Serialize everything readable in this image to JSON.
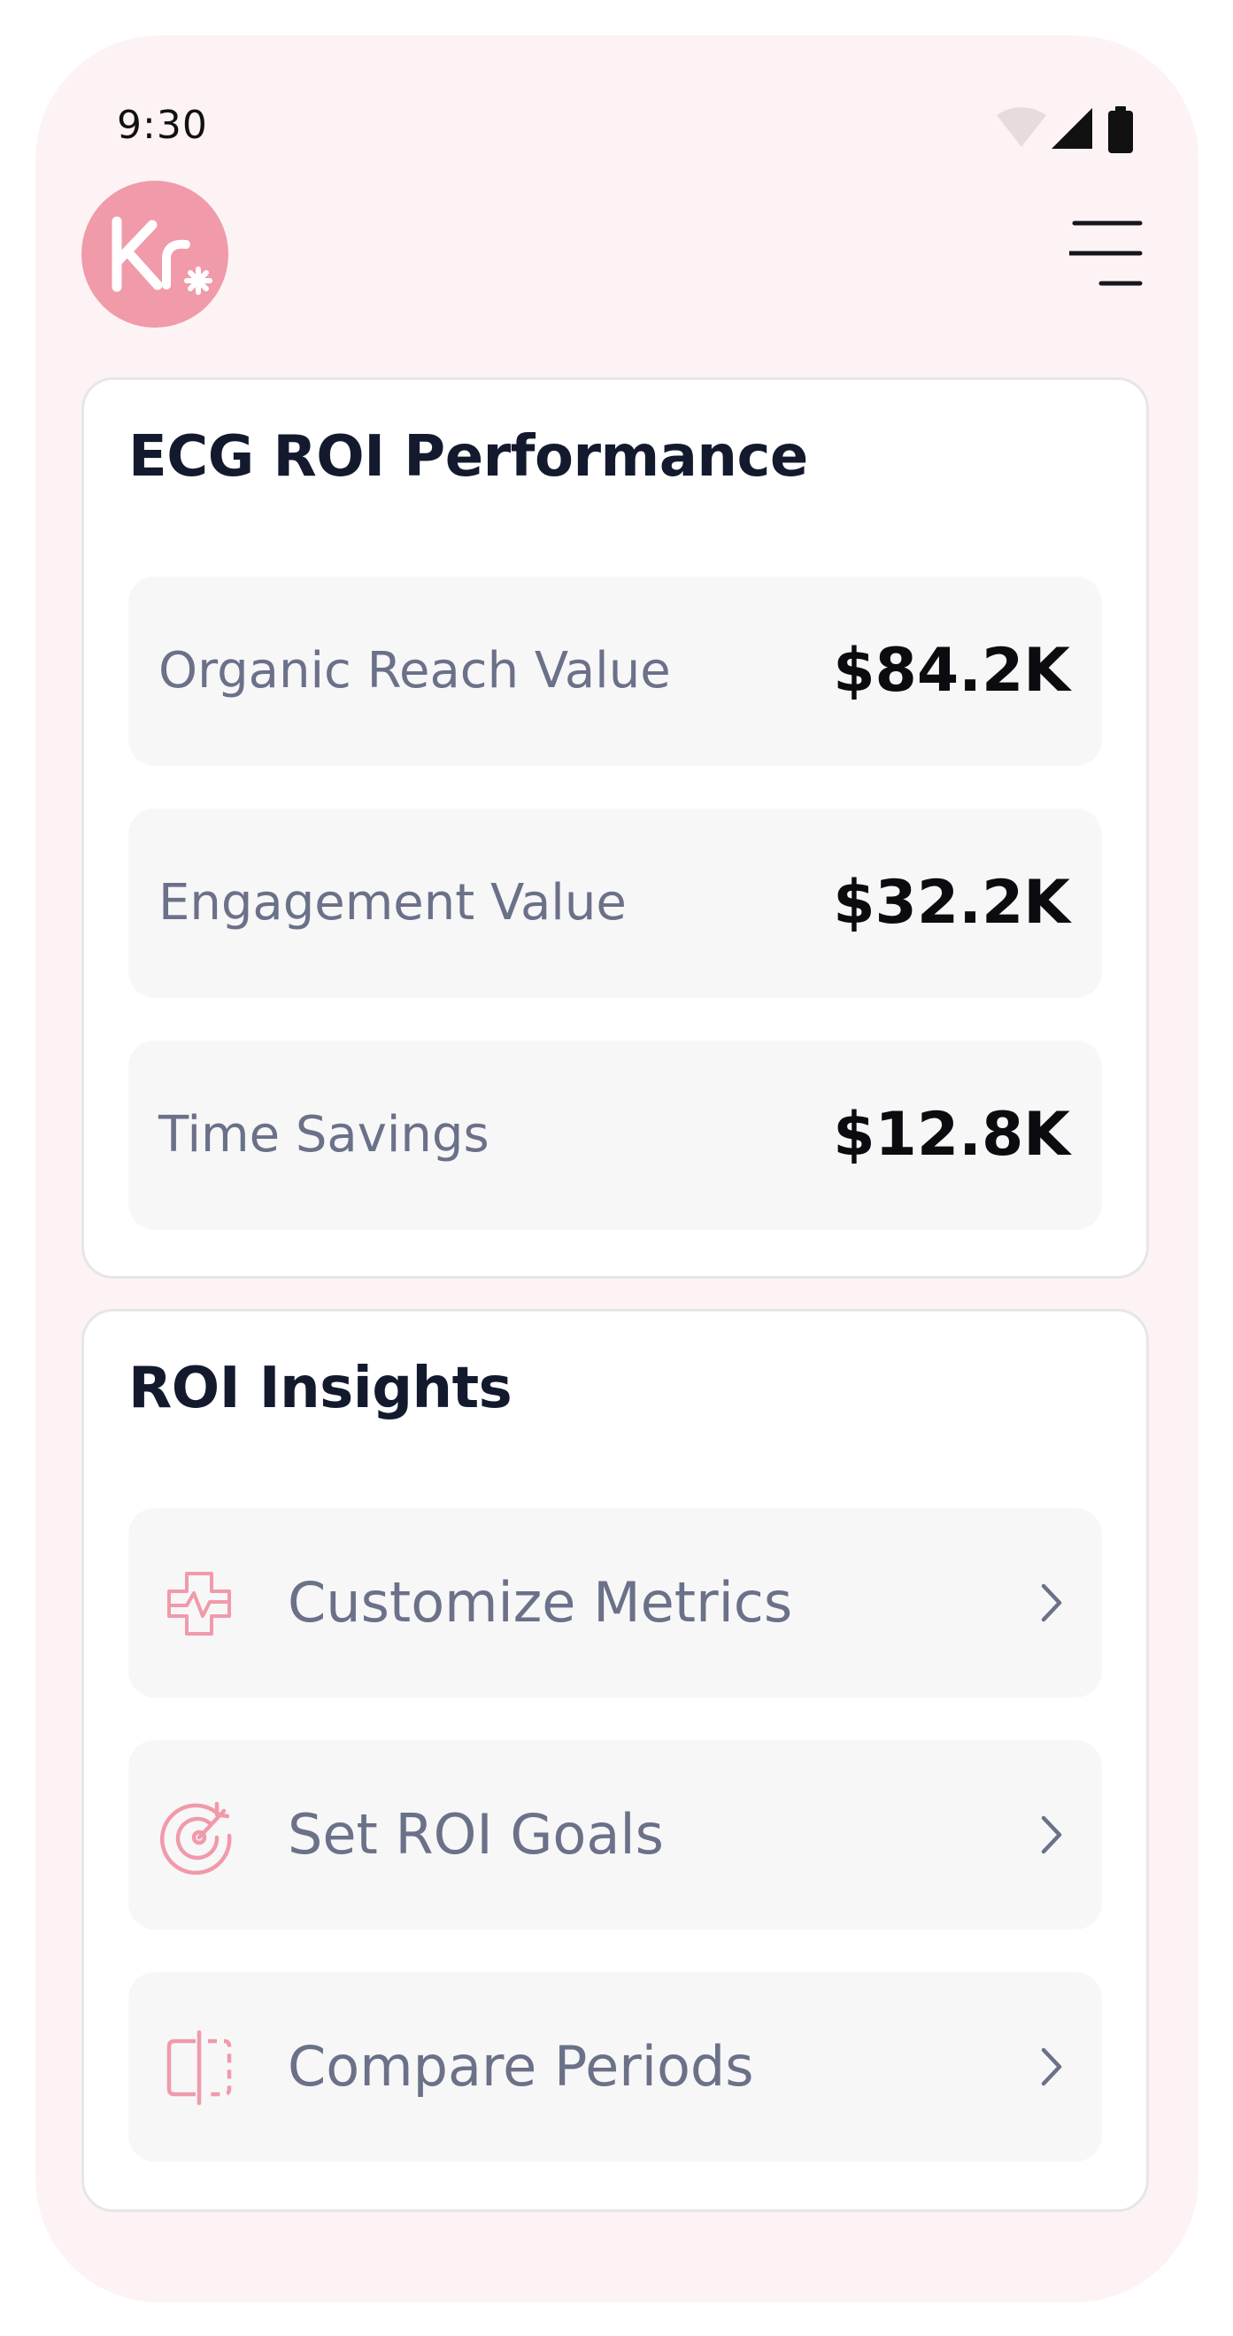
{
  "status_bar": {
    "time": "9:30",
    "icons": [
      "wifi-icon",
      "cellular-signal-icon",
      "battery-icon"
    ]
  },
  "header": {
    "logo_text": "Kr",
    "logo_color": "#f09aaa",
    "menu_icon": "hamburger-menu-icon"
  },
  "performance_card": {
    "title": "ECG ROI Performance",
    "metrics": [
      {
        "label": "Organic Reach Value",
        "value": "$84.2K"
      },
      {
        "label": "Engagement Value",
        "value": "$32.2K"
      },
      {
        "label": "Time Savings",
        "value": "$12.8K"
      }
    ]
  },
  "insights_card": {
    "title": "ROI Insights",
    "actions": [
      {
        "label": "Customize Metrics",
        "icon": "heart-pulse-icon"
      },
      {
        "label": "Set ROI Goals",
        "icon": "target-icon"
      },
      {
        "label": "Compare Periods",
        "icon": "compare-icon"
      }
    ]
  },
  "colors": {
    "background": "#fdf3f4",
    "accent": "#f09aaa",
    "title_text": "#141a2e",
    "muted_text": "#6a7188"
  }
}
